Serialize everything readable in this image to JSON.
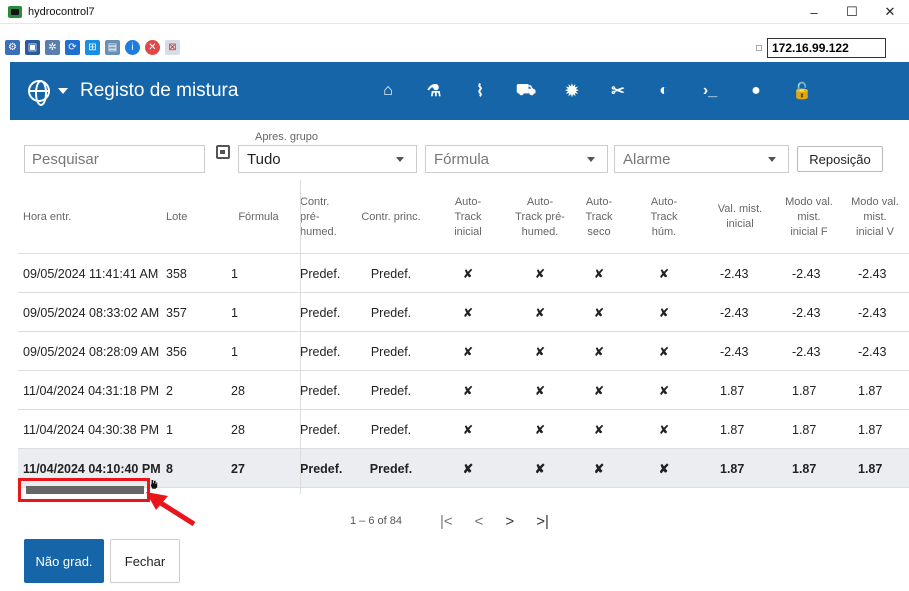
{
  "window": {
    "title": "hydrocontrol7",
    "controls": [
      "–",
      "☐",
      "✕"
    ]
  },
  "remote_toolbar": {
    "icon_names": [
      "settings-icon",
      "fullscreen-icon",
      "gear-icon",
      "refresh-icon",
      "windows-icon",
      "view-icon",
      "info-icon",
      "close-icon",
      "disconnect-icon"
    ],
    "ip_address": "172.16.99.122"
  },
  "app_bar": {
    "title": "Registo de mistura",
    "nav_icons": [
      "home-icon",
      "flask-icon",
      "chart-icon",
      "plant-icon",
      "gear-icon",
      "tools-icon",
      "toggle-icon",
      "terminal-icon",
      "user-icon",
      "lock-icon"
    ],
    "nav_glyphs": [
      "⌂",
      "⚗",
      "⌇",
      "⛟",
      "✹",
      "✂",
      "◐",
      "›_",
      "●",
      "🔓"
    ]
  },
  "filters": {
    "search_placeholder": "Pesquisar",
    "group_label": "Apres. grupo",
    "group_value": "Tudo",
    "formula_placeholder": "Fórmula",
    "alarm_placeholder": "Alarme",
    "reset_label": "Reposição"
  },
  "table": {
    "headers": [
      "Hora entr.",
      "Lote",
      "Fórmula",
      "Contr.\npré-\nhumed.",
      "Contr. princ.",
      "Auto-\nTrack\ninicial",
      "Auto-\nTrack pré-\nhumed.",
      "Auto-\nTrack\nseco",
      "Auto-\nTrack\nhúm.",
      "Val. mist.\ninicial",
      "Modo val.\nmist.\ninicial F",
      "Modo val.\nmist.\ninicial V"
    ],
    "rows": [
      [
        "09/05/2024 11:41:41 AM",
        "358",
        "1",
        "Predef.",
        "Predef.",
        "✘",
        "✘",
        "✘",
        "✘",
        "-2.43",
        "-2.43",
        "-2.43"
      ],
      [
        "09/05/2024 08:33:02 AM",
        "357",
        "1",
        "Predef.",
        "Predef.",
        "✘",
        "✘",
        "✘",
        "✘",
        "-2.43",
        "-2.43",
        "-2.43"
      ],
      [
        "09/05/2024 08:28:09 AM",
        "356",
        "1",
        "Predef.",
        "Predef.",
        "✘",
        "✘",
        "✘",
        "✘",
        "-2.43",
        "-2.43",
        "-2.43"
      ],
      [
        "11/04/2024 04:31:18 PM",
        "2",
        "28",
        "Predef.",
        "Predef.",
        "✘",
        "✘",
        "✘",
        "✘",
        "1.87",
        "1.87",
        "1.87"
      ],
      [
        "11/04/2024 04:30:38 PM",
        "1",
        "28",
        "Predef.",
        "Predef.",
        "✘",
        "✘",
        "✘",
        "✘",
        "1.87",
        "1.87",
        "1.87"
      ],
      [
        "11/04/2024 04:10:40 PM",
        "8",
        "27",
        "Predef.",
        "Predef.",
        "✘",
        "✘",
        "✘",
        "✘",
        "1.87",
        "1.87",
        "1.87"
      ]
    ],
    "selected_row": 5
  },
  "pagination": {
    "range": "1 – 6 of 84",
    "first": "|<",
    "prev": "<",
    "next": ">",
    "last": ">|"
  },
  "actions": {
    "primary_label": "Não grad.",
    "close_label": "Fechar"
  },
  "colors": {
    "app_bar": "#1565a8",
    "primary_button": "#1565a8",
    "annotation": "#e8151a"
  }
}
